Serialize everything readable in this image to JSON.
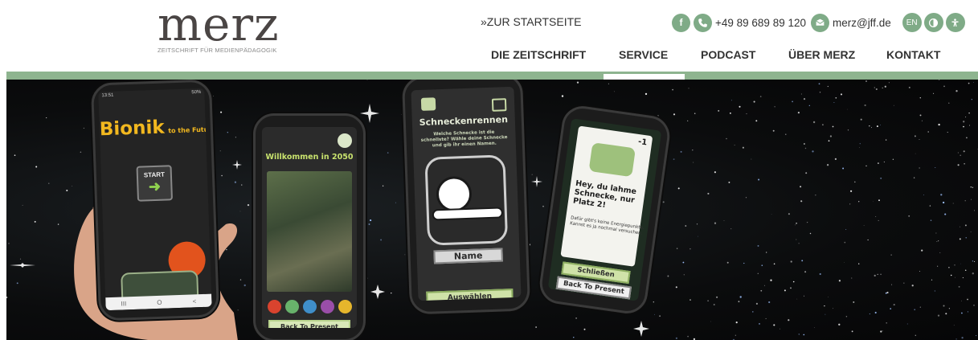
{
  "header": {
    "logo_word": "merz",
    "logo_subtitle": "ZEITSCHRIFT FÜR MEDIENPÄDAGOGIK",
    "home_link": "»ZUR STARTSEITE",
    "phone": "+49 89 689 89 120",
    "email": "merz@jff.de",
    "lang": "EN",
    "icons": {
      "facebook": "facebook-icon",
      "phone": "phone-icon",
      "email": "email-icon",
      "contrast": "contrast-icon",
      "accessibility": "accessibility-icon"
    },
    "accent_color": "#7fab87"
  },
  "nav": {
    "items": [
      {
        "label": "DIE ZEITSCHRIFT"
      },
      {
        "label": "SERVICE",
        "active": true
      },
      {
        "label": "PODCAST"
      },
      {
        "label": "ÜBER MERZ"
      },
      {
        "label": "KONTAKT"
      }
    ]
  },
  "hero": {
    "phone1": {
      "status_time": "13:51",
      "status_battery": "50%",
      "title_big": "Bionik",
      "title_small": "to the Future",
      "start_label": "START",
      "nav_buttons": [
        "III",
        "O",
        "<"
      ]
    },
    "phone2": {
      "title": "Willkommen in 2050",
      "back_button": "Back To Present"
    },
    "phone3": {
      "title": "Schneckenrennen",
      "subtitle": "Welche Schnecke ist die schnellste? Wähle deine Schnecke und gib ihr einen Namen.",
      "name_field": "Name",
      "select_button": "Auswählen"
    },
    "phone4": {
      "score": "-1",
      "message": "Hey, du lahme Schnecke, nur Platz 2!",
      "subtext": "Dafür gibt's keine Energiepunkte. Kannst es ja nochmal versuchen.",
      "close_button": "Schließen",
      "back_button": "Back To Present"
    }
  }
}
